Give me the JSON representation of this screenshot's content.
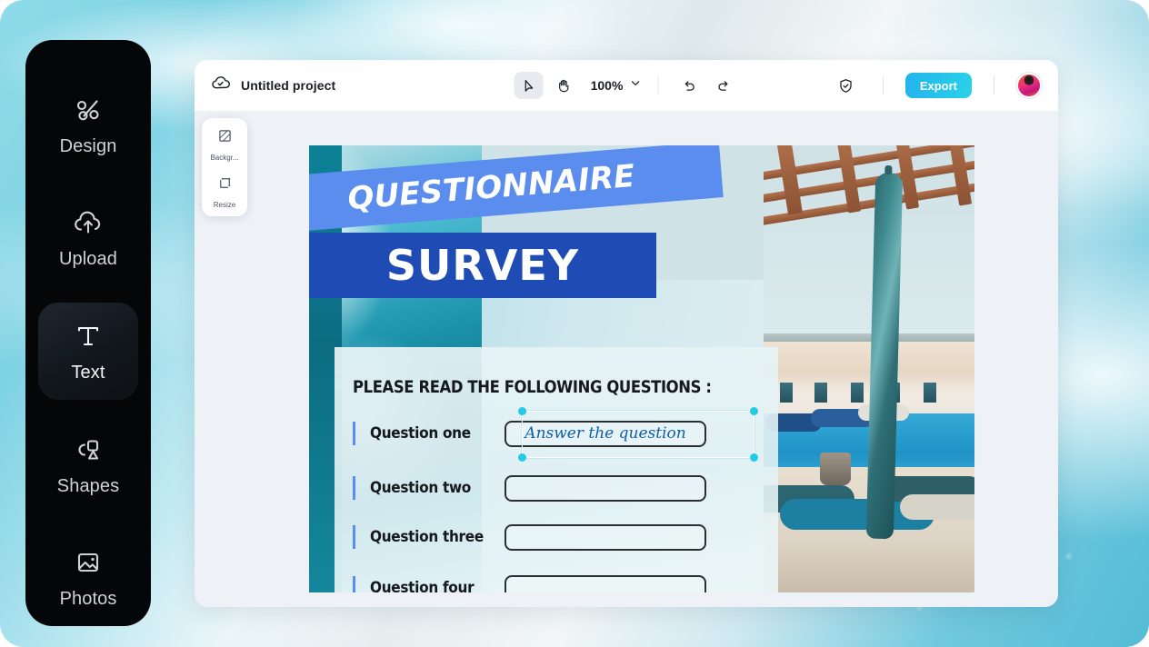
{
  "app": {
    "sidebar": {
      "items": [
        {
          "label": "Design",
          "icon": "design-icon",
          "active": false
        },
        {
          "label": "Upload",
          "icon": "upload-cloud-icon",
          "active": false
        },
        {
          "label": "Text",
          "icon": "text-t-icon",
          "active": true
        },
        {
          "label": "Shapes",
          "icon": "shapes-icon",
          "active": false
        },
        {
          "label": "Photos",
          "icon": "photo-icon",
          "active": false
        }
      ]
    },
    "toolbar": {
      "cloud_icon": "cloud-check-icon",
      "project_title": "Untitled project",
      "select_tool_icon": "cursor-arrow-icon",
      "hand_tool_icon": "hand-icon",
      "zoom_level": "100%",
      "zoom_chevron_icon": "chevron-down-icon",
      "undo_icon": "undo-arrow-icon",
      "redo_icon": "redo-arrow-icon",
      "shield_icon": "shield-check-icon",
      "export_label": "Export",
      "avatar_name": "user-avatar"
    },
    "side_panel": {
      "items": [
        {
          "label": "Backgr...",
          "icon": "background-swatch-icon"
        },
        {
          "label": "Resize",
          "icon": "resize-frame-icon"
        }
      ]
    }
  },
  "design": {
    "banner_top": "QUESTIONNAIRE",
    "banner_bottom": "SURVEY",
    "heading": "PLEASE READ THE FOLLOWING QUESTIONS :",
    "questions": [
      {
        "label": "Question one",
        "answer": "Answer the question",
        "selected": true
      },
      {
        "label": "Question two",
        "answer": "",
        "selected": false
      },
      {
        "label": "Question three",
        "answer": "",
        "selected": false
      },
      {
        "label": "Question four",
        "answer": "",
        "selected": false
      }
    ]
  },
  "colors": {
    "accent_export": "#2ac6e6",
    "banner_light_blue": "#5b8dee",
    "banner_dark_blue": "#1f4bb5",
    "selection_handle": "#22cbe6",
    "answer_text": "#0f5fa8",
    "sidebar_bg": "#050608",
    "workspace_bg": "#eef1f5"
  }
}
